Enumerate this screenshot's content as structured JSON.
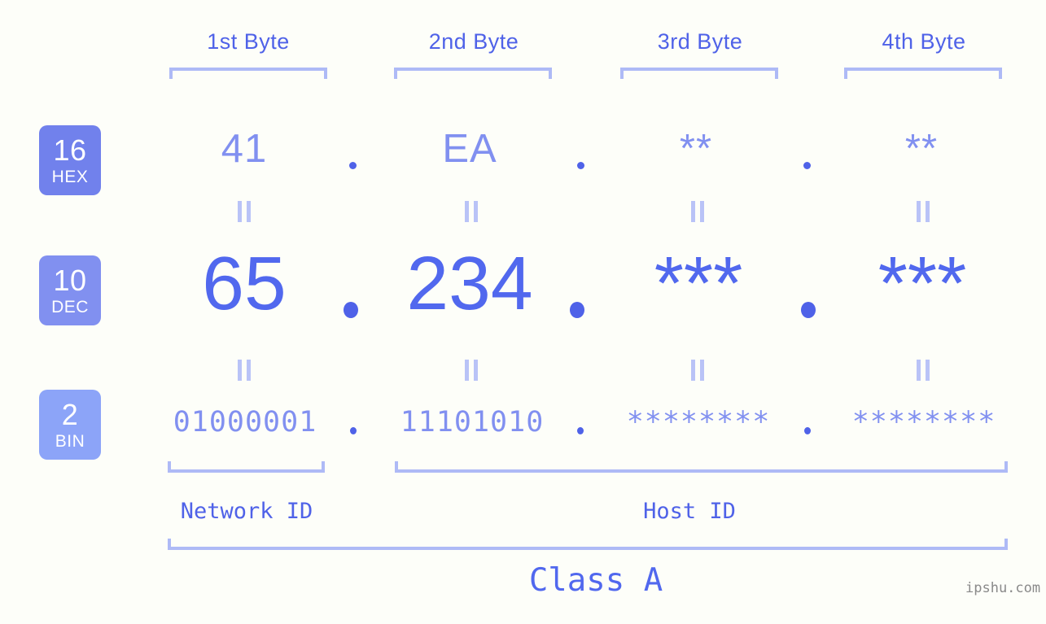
{
  "meta": {
    "background_color": "#fdfef9",
    "accent_color": "#5168ee",
    "light_accent_color": "#8190f0",
    "bracket_color": "#aebaf6",
    "watermark": "ipshu.com"
  },
  "byte_headers": [
    {
      "label": "1st Byte"
    },
    {
      "label": "2nd Byte"
    },
    {
      "label": "3rd Byte"
    },
    {
      "label": "4th Byte"
    }
  ],
  "rows": [
    {
      "badge": {
        "num": "16",
        "label": "HEX",
        "color": "#7181ec"
      },
      "values": [
        "41",
        "EA",
        "**",
        "**"
      ],
      "separator": "."
    },
    {
      "badge": {
        "num": "10",
        "label": "DEC",
        "color": "#8190f0"
      },
      "values": [
        "65",
        "234",
        "***",
        "***"
      ],
      "separator": "."
    },
    {
      "badge": {
        "num": "2",
        "label": "BIN",
        "color": "#8ca4f8"
      },
      "values": [
        "01000001",
        "11101010",
        "********",
        "********"
      ],
      "separator": "."
    }
  ],
  "equals_symbol": "=",
  "segments": {
    "network_id": "Network ID",
    "host_id": "Host ID"
  },
  "class_label": "Class A"
}
